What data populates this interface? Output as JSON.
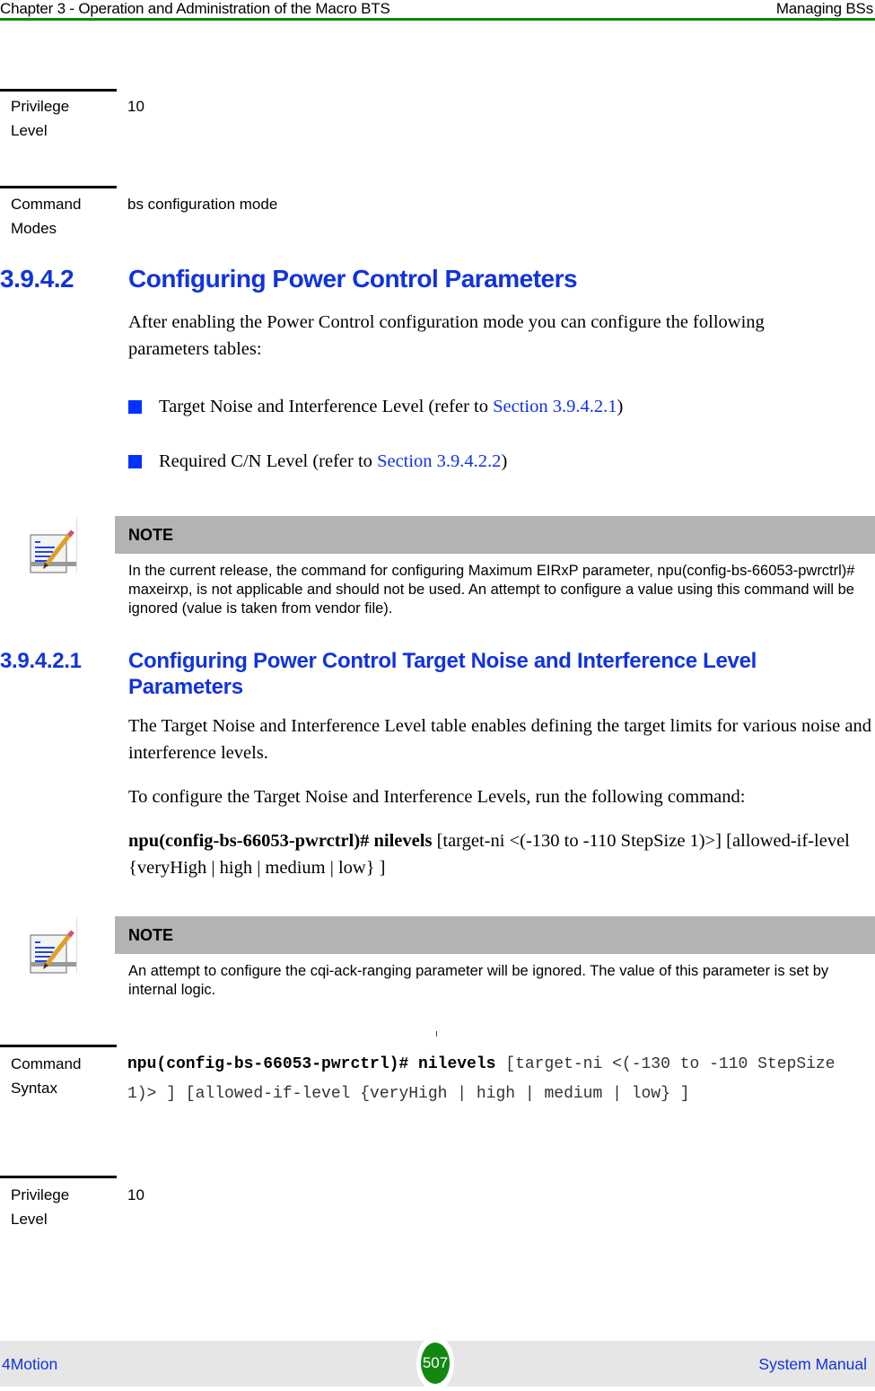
{
  "header": {
    "chapter": "Chapter 3 - Operation and Administration of the Macro BTS",
    "section": "Managing BSs"
  },
  "top_blocks": [
    {
      "label_line1": "Privilege",
      "label_line2": "Level",
      "value": "10"
    },
    {
      "label_line1": "Command",
      "label_line2": "Modes",
      "value": "bs configuration mode"
    }
  ],
  "section_3_9_4_2": {
    "number": "3.9.4.2",
    "title": "Configuring Power Control Parameters",
    "intro": "After enabling the Power Control configuration mode you can configure the following parameters tables:",
    "bullets": [
      {
        "text": "Target Noise and Interference Level (refer to ",
        "link": "Section 3.9.4.2.1",
        "suffix": ")"
      },
      {
        "text": "Required C/N Level (refer to ",
        "link": "Section 3.9.4.2.2",
        "suffix": ")"
      }
    ]
  },
  "note1": {
    "icon": "note-pencil-icon",
    "title": "NOTE",
    "text": "In the current release, the command for configuring Maximum EIRxP parameter, npu(config-bs-66053-pwrctrl)# maxeirxp, is not applicable and should not be used. An attempt to configure a value using this command will be ignored (value is taken from vendor file)."
  },
  "section_3_9_4_2_1": {
    "number": "3.9.4.2.1",
    "title": "Configuring Power Control Target Noise and Interference Level Parameters",
    "para1": "The Target Noise and Interference Level table enables defining the target limits for various noise and interference levels.",
    "para2": "To configure the Target Noise and Interference Levels, run the following command:",
    "command_bold": "npu(config-bs-66053-pwrctrl)# nilevels",
    "command_rest": " [target-ni <(-130 to -110 StepSize 1)>] [allowed-if-level {veryHigh | high | medium | low} ]"
  },
  "note2": {
    "icon": "note-pencil-icon",
    "title": "NOTE",
    "text": "An attempt to configure the cqi-ack-ranging parameter will be ignored. The value of this parameter is set by internal logic."
  },
  "command_syntax": {
    "label_line1": "Command",
    "label_line2": "Syntax",
    "bold": "npu(config-bs-66053-pwrctrl)# nilevels",
    "rest": " [target-ni <(-130 to -110 StepSize 1)> ] [allowed-if-level {veryHigh | high | medium | low} ]"
  },
  "privilege_bottom": {
    "label_line1": "Privilege",
    "label_line2": "Level",
    "value": "10"
  },
  "footer": {
    "product": "4Motion",
    "page": "507",
    "manual": "System Manual"
  },
  "colors": {
    "heading_blue": "#1133dd",
    "rule_green": "#118811",
    "bullet_blue": "#0033ff",
    "note_bar_gray": "#b3b3b3",
    "footer_gray": "#e6e6e6"
  }
}
